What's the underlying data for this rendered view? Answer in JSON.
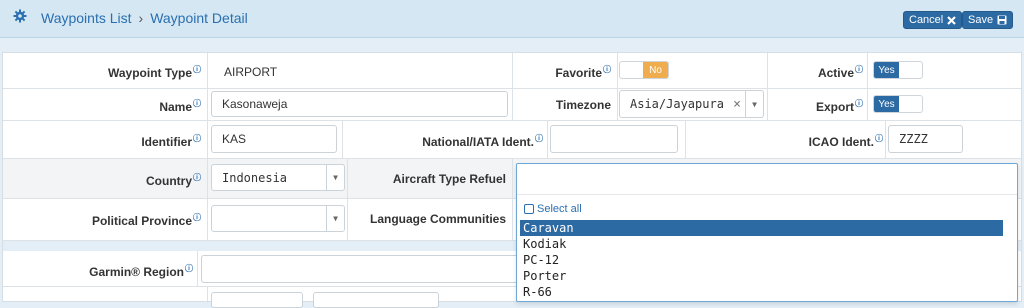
{
  "header": {
    "breadcrumb": [
      "Waypoints List",
      "Waypoint Detail"
    ],
    "cancel_label": "Cancel",
    "save_label": "Save"
  },
  "form": {
    "waypoint_type": {
      "label": "Waypoint Type",
      "value": "AIRPORT"
    },
    "favorite": {
      "label": "Favorite",
      "value": "No"
    },
    "active": {
      "label": "Active",
      "value": "Yes"
    },
    "name": {
      "label": "Name",
      "value": "Kasonaweja"
    },
    "timezone": {
      "label": "Timezone",
      "value": "Asia/Jayapura"
    },
    "export": {
      "label": "Export",
      "value": "Yes"
    },
    "identifier": {
      "label": "Identifier",
      "value": "KAS"
    },
    "national_iata": {
      "label": "National/IATA Ident.",
      "value": ""
    },
    "icao": {
      "label": "ICAO Ident.",
      "value": "ZZZZ"
    },
    "country": {
      "label": "Country",
      "value": "Indonesia"
    },
    "aircraft_type_refuel": {
      "label": "Aircraft Type Refuel"
    },
    "political_province": {
      "label": "Political Province",
      "value": ""
    },
    "language_communities": {
      "label": "Language Communities"
    },
    "garmin_region": {
      "label": "Garmin® Region",
      "value": ""
    }
  },
  "dropdown": {
    "select_all": "Select all",
    "options": [
      "Caravan",
      "Kodiak",
      "PC-12",
      "Porter",
      "R-66"
    ],
    "selected": "Caravan"
  },
  "colors": {
    "accent": "#2c6aa3",
    "header_bg": "#d4e7f3",
    "toggle_off": "#f0ad4e"
  },
  "icons": {
    "header": "gear-icon",
    "cancel": "close-icon",
    "save": "save-icon",
    "help": "help-icon"
  }
}
